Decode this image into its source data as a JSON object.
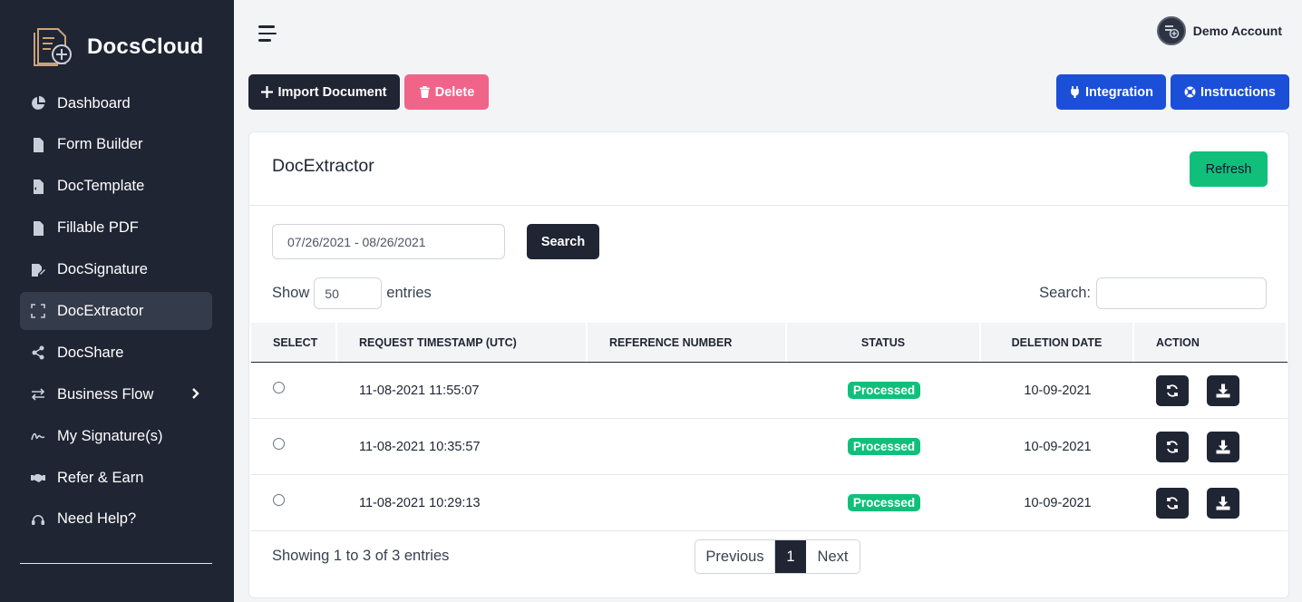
{
  "brand": {
    "name": "DocsCloud"
  },
  "sidebar": {
    "items": [
      {
        "label": "Dashboard",
        "icon": "pie-chart-icon"
      },
      {
        "label": "Form Builder",
        "icon": "file-icon"
      },
      {
        "label": "DocTemplate",
        "icon": "file-code-icon"
      },
      {
        "label": "Fillable PDF",
        "icon": "file-icon"
      },
      {
        "label": "DocSignature",
        "icon": "file-signature-icon"
      },
      {
        "label": "DocExtractor",
        "icon": "expand-icon",
        "active": true
      },
      {
        "label": "DocShare",
        "icon": "share-icon"
      },
      {
        "label": "Business Flow",
        "icon": "exchange-icon",
        "has_submenu": true
      },
      {
        "label": "My Signature(s)",
        "icon": "signature-icon"
      },
      {
        "label": "Refer & Earn",
        "icon": "handshake-icon"
      },
      {
        "label": "Need Help?",
        "icon": "headset-icon"
      }
    ]
  },
  "header": {
    "account_name": "Demo Account"
  },
  "toolbar": {
    "import_label": "Import Document",
    "delete_label": "Delete",
    "integration_label": "Integration",
    "instructions_label": "Instructions"
  },
  "card": {
    "title": "DocExtractor",
    "refresh_label": "Refresh",
    "date_range": "07/26/2021 - 08/26/2021",
    "search_button": "Search",
    "show_label": "Show",
    "entries_value": "50",
    "entries_label": "entries",
    "search_label": "Search:"
  },
  "table": {
    "columns": [
      "SELECT",
      "REQUEST TIMESTAMP (UTC)",
      "REFERENCE NUMBER",
      "STATUS",
      "DELETION DATE",
      "ACTION"
    ],
    "rows": [
      {
        "timestamp": "11-08-2021 11:55:07",
        "reference": "",
        "status": "Processed",
        "deletion": "10-09-2021"
      },
      {
        "timestamp": "11-08-2021 10:35:57",
        "reference": "",
        "status": "Processed",
        "deletion": "10-09-2021"
      },
      {
        "timestamp": "11-08-2021 10:29:13",
        "reference": "",
        "status": "Processed",
        "deletion": "10-09-2021"
      }
    ]
  },
  "footer": {
    "info": "Showing 1 to 3 of 3 entries",
    "previous": "Previous",
    "current_page": "1",
    "next": "Next"
  },
  "colors": {
    "sidebar": "#1f2533",
    "accent_blue": "#1b4fd8",
    "success": "#10c07a",
    "danger": "#f0648a"
  }
}
